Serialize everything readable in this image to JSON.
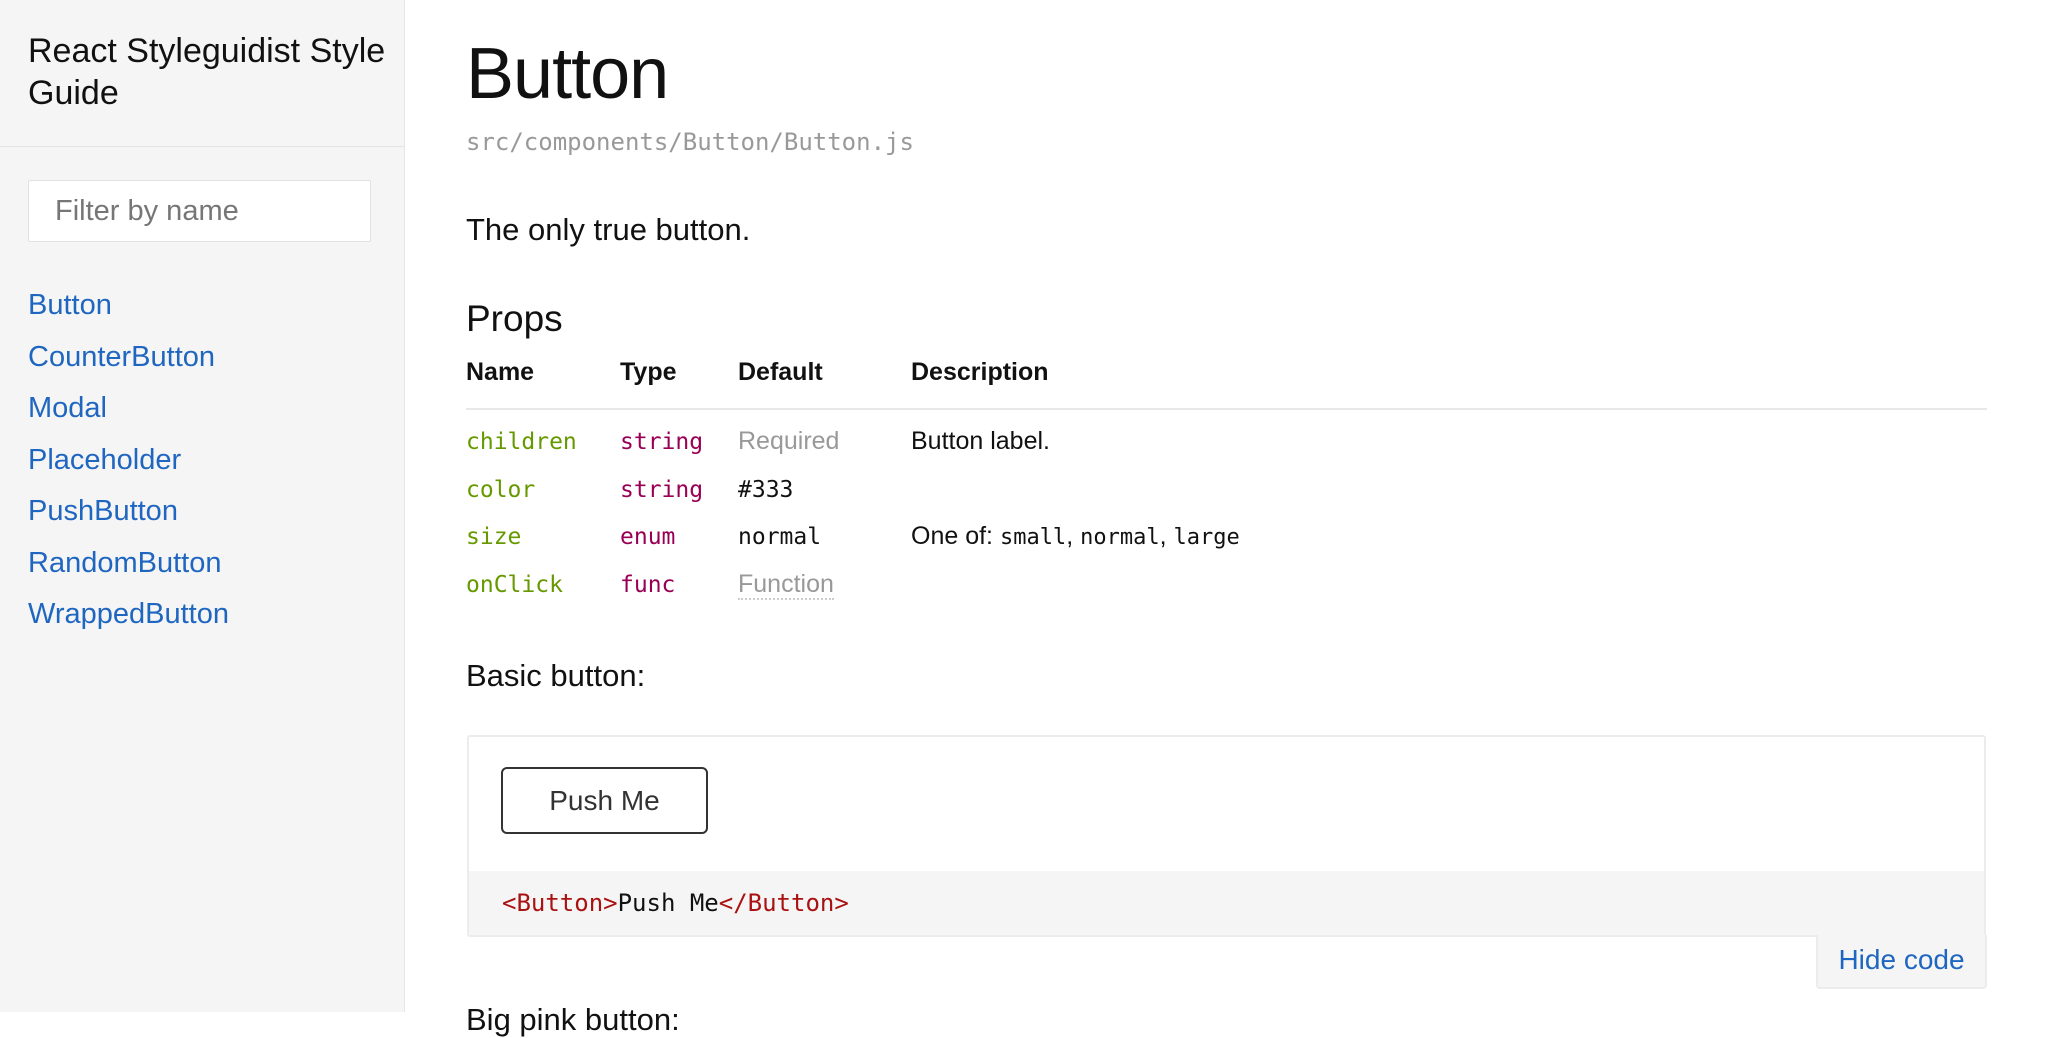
{
  "sidebar": {
    "title": "React Styleguidist Style Guide",
    "filter": {
      "placeholder": "Filter by name",
      "value": ""
    },
    "items": [
      {
        "label": "Button"
      },
      {
        "label": "CounterButton"
      },
      {
        "label": "Modal"
      },
      {
        "label": "Placeholder"
      },
      {
        "label": "PushButton"
      },
      {
        "label": "RandomButton"
      },
      {
        "label": "WrappedButton"
      }
    ]
  },
  "component": {
    "name": "Button",
    "path": "src/components/Button/Button.js",
    "description": "The only true button.",
    "props_heading": "Props",
    "props_table": {
      "headers": [
        "Name",
        "Type",
        "Default",
        "Description"
      ],
      "rows": [
        {
          "name": "children",
          "type": "string",
          "default": "Required",
          "default_style": "muted",
          "description": "Button label.",
          "description_code": []
        },
        {
          "name": "color",
          "type": "string",
          "default": "#333",
          "default_style": "code",
          "description": "",
          "description_code": []
        },
        {
          "name": "size",
          "type": "enum",
          "default": "normal",
          "default_style": "code",
          "description": "One of:",
          "description_code": [
            "small",
            "normal",
            "large"
          ]
        },
        {
          "name": "onClick",
          "type": "func",
          "default": "Function",
          "default_style": "func",
          "description": "",
          "description_code": []
        }
      ]
    },
    "example": {
      "label": "Basic button:",
      "preview_button_label": "Push Me",
      "code": {
        "open_tag": "<Button>",
        "content": "Push Me",
        "close_tag": "</Button>"
      },
      "toggle_label": "Hide code"
    },
    "next_section_peek": "Big pink button:"
  },
  "colors": {
    "link": "#1f66c0",
    "prop_name": "#669900",
    "prop_type": "#990055",
    "muted": "#999999",
    "code_tag": "#aa1111",
    "sidebar_bg": "#f5f5f5"
  }
}
